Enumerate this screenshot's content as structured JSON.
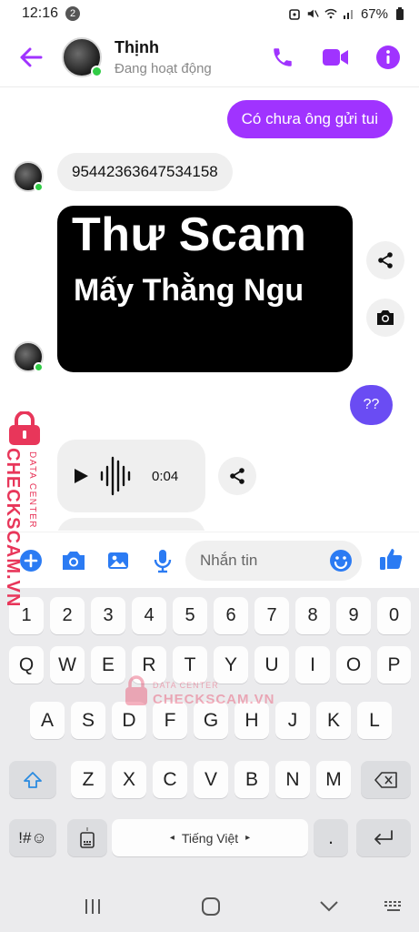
{
  "status_bar": {
    "time": "12:16",
    "notification_count": "2",
    "battery": "67%"
  },
  "header": {
    "contact_name": "Thịnh",
    "contact_status": "Đang hoạt động"
  },
  "messages": {
    "sent_1": "Có chưa ông gửi tui",
    "received_1": "95442363647534158",
    "image_text_line1": "Thư Scam",
    "image_text_line2": "Mấy Thằng Ngu",
    "sent_2": "??",
    "voice_duration": "0:04"
  },
  "composer": {
    "placeholder": "Nhắn tin"
  },
  "watermark": {
    "brand": "CHECKSCAM.VN",
    "sub": "DATA CENTER",
    "brand_center": "CHECKSCAM.VN"
  },
  "keyboard": {
    "numbers": [
      "1",
      "2",
      "3",
      "4",
      "5",
      "6",
      "7",
      "8",
      "9",
      "0"
    ],
    "row1": [
      "Q",
      "W",
      "E",
      "R",
      "T",
      "Y",
      "U",
      "I",
      "O",
      "P"
    ],
    "row2": [
      "A",
      "S",
      "D",
      "F",
      "G",
      "H",
      "J",
      "K",
      "L"
    ],
    "row3": [
      "Z",
      "X",
      "C",
      "V",
      "B",
      "N",
      "M"
    ],
    "symbols_key": "!#☺",
    "space_label": "Tiếng Việt",
    "period_key": "."
  },
  "colors": {
    "accent": "#a033ff",
    "online": "#31cc46",
    "purple_bubble": "#6a4cf3",
    "keyboard_bg": "#ebebed",
    "watermark": "#e8365a",
    "like": "#2b7bf3"
  },
  "icons": [
    "back-arrow-icon",
    "phone-icon",
    "video-icon",
    "info-icon",
    "share-icon",
    "camera-icon",
    "play-icon",
    "waveform-icon",
    "plus-icon",
    "image-icon",
    "mic-icon",
    "emoji-icon",
    "thumbs-up-icon",
    "shift-icon",
    "backspace-icon",
    "enter-icon",
    "keyboard-settings-icon",
    "recents-icon",
    "home-icon",
    "back-nav-icon",
    "keyboard-hide-icon",
    "lock-icon"
  ]
}
